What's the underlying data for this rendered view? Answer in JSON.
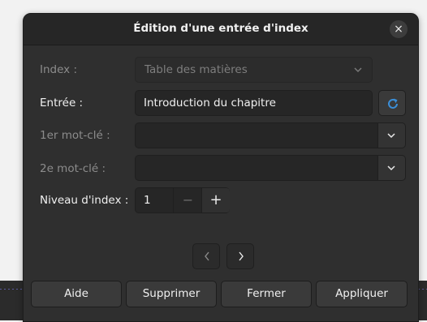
{
  "dialog": {
    "title": "Édition d'une entrée d'index",
    "close_symbol": "×"
  },
  "form": {
    "index": {
      "label": "Index :",
      "value": "Table des matières"
    },
    "entry": {
      "label": "Entrée :",
      "value": "Introduction du chapitre"
    },
    "key1": {
      "label": "1er mot-clé :",
      "value": ""
    },
    "key2": {
      "label": "2e mot-clé :",
      "value": ""
    },
    "level": {
      "label": "Niveau d'index :",
      "value": "1",
      "minus": "−",
      "plus": "+"
    }
  },
  "buttons": {
    "help": "Aide",
    "delete": "Supprimer",
    "close": "Fermer",
    "apply": "Appliquer"
  },
  "icons": {
    "refresh": "refresh-icon",
    "chevron": "chevron-down-icon",
    "prev": "chevron-left-icon",
    "next": "chevron-right-icon"
  },
  "colors": {
    "accent": "#3b8fd9",
    "dialog_bg": "#2f2f2f"
  }
}
